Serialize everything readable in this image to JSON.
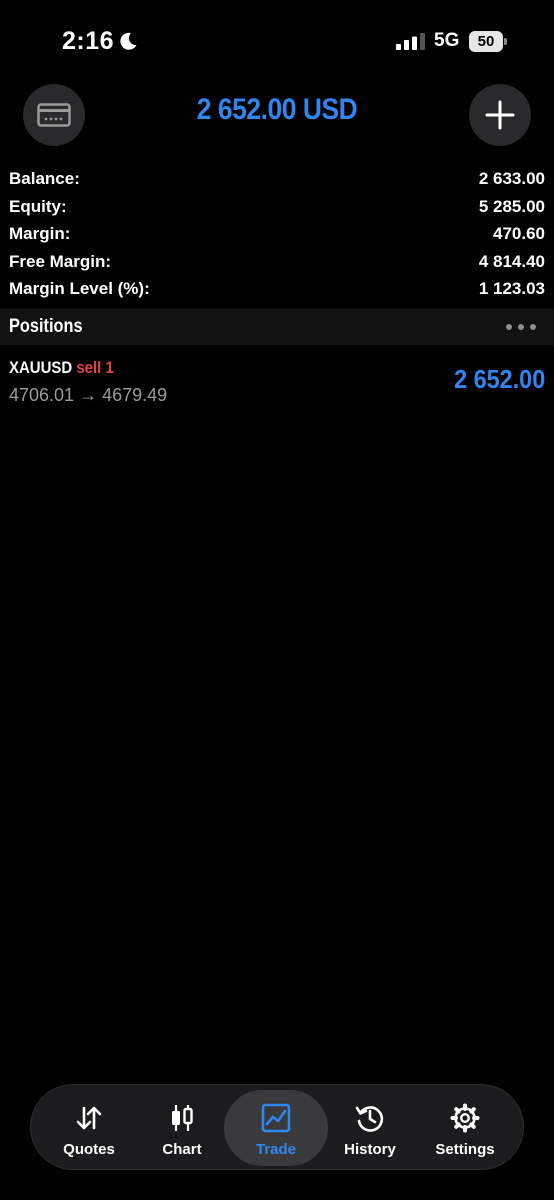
{
  "status_bar": {
    "time": "2:16",
    "network": "5G",
    "battery": "50"
  },
  "header": {
    "total": "2 652.00 USD",
    "left_icon": "card-icon",
    "right_icon": "plus-icon"
  },
  "account": {
    "rows": [
      {
        "label": "Balance:",
        "value": "2 633.00"
      },
      {
        "label": "Equity:",
        "value": "5 285.00"
      },
      {
        "label": "Margin:",
        "value": "470.60"
      },
      {
        "label": "Free Margin:",
        "value": "4 814.40"
      },
      {
        "label": "Margin Level (%):",
        "value": "1 123.03"
      }
    ]
  },
  "positions": {
    "title": "Positions",
    "items": [
      {
        "symbol": "XAUUSD",
        "side": "sell 1",
        "open_price": "4706.01",
        "arrow": "→",
        "current_price": "4679.49",
        "profit": "2 652.00"
      }
    ]
  },
  "tab_bar": {
    "tabs": [
      {
        "label": "Quotes",
        "icon": "quotes-arrows-icon"
      },
      {
        "label": "Chart",
        "icon": "candlestick-icon"
      },
      {
        "label": "Trade",
        "icon": "trade-chart-icon",
        "active": true
      },
      {
        "label": "History",
        "icon": "history-clock-icon"
      },
      {
        "label": "Settings",
        "icon": "gear-icon"
      }
    ]
  },
  "colors": {
    "accent": "#2f86f0",
    "sell": "#e5433c",
    "background": "#000000"
  }
}
